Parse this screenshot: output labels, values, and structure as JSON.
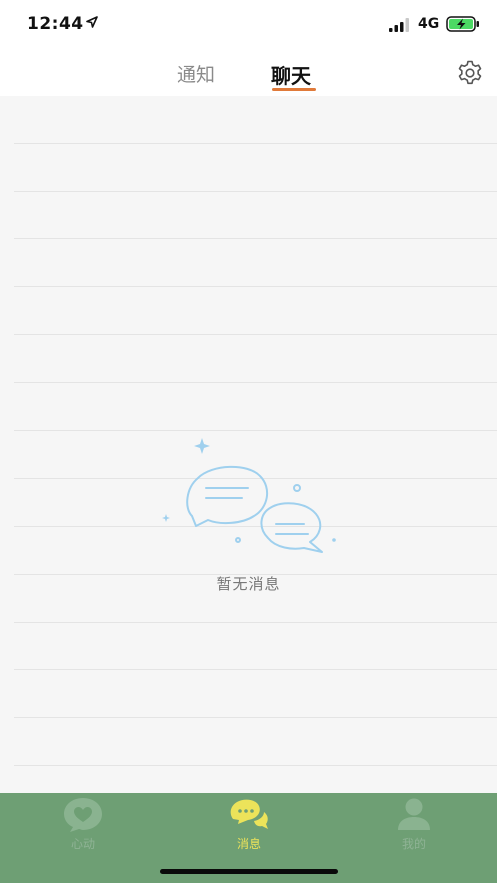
{
  "status_bar": {
    "time": "12:44",
    "network": "4G"
  },
  "top_tabs": {
    "notice": "通知",
    "chat": "聊天",
    "active": "chat",
    "accent_color": "#e07a3a"
  },
  "empty_state": {
    "text": "暂无消息",
    "illustration": "chat-bubbles-icon"
  },
  "bottom_nav": {
    "background": "#6e9f74",
    "items": [
      {
        "label": "心动",
        "icon": "heart-bubble-icon",
        "active": false
      },
      {
        "label": "消息",
        "icon": "chat-bubbles-icon",
        "active": true
      },
      {
        "label": "我的",
        "icon": "person-icon",
        "active": false
      }
    ]
  }
}
